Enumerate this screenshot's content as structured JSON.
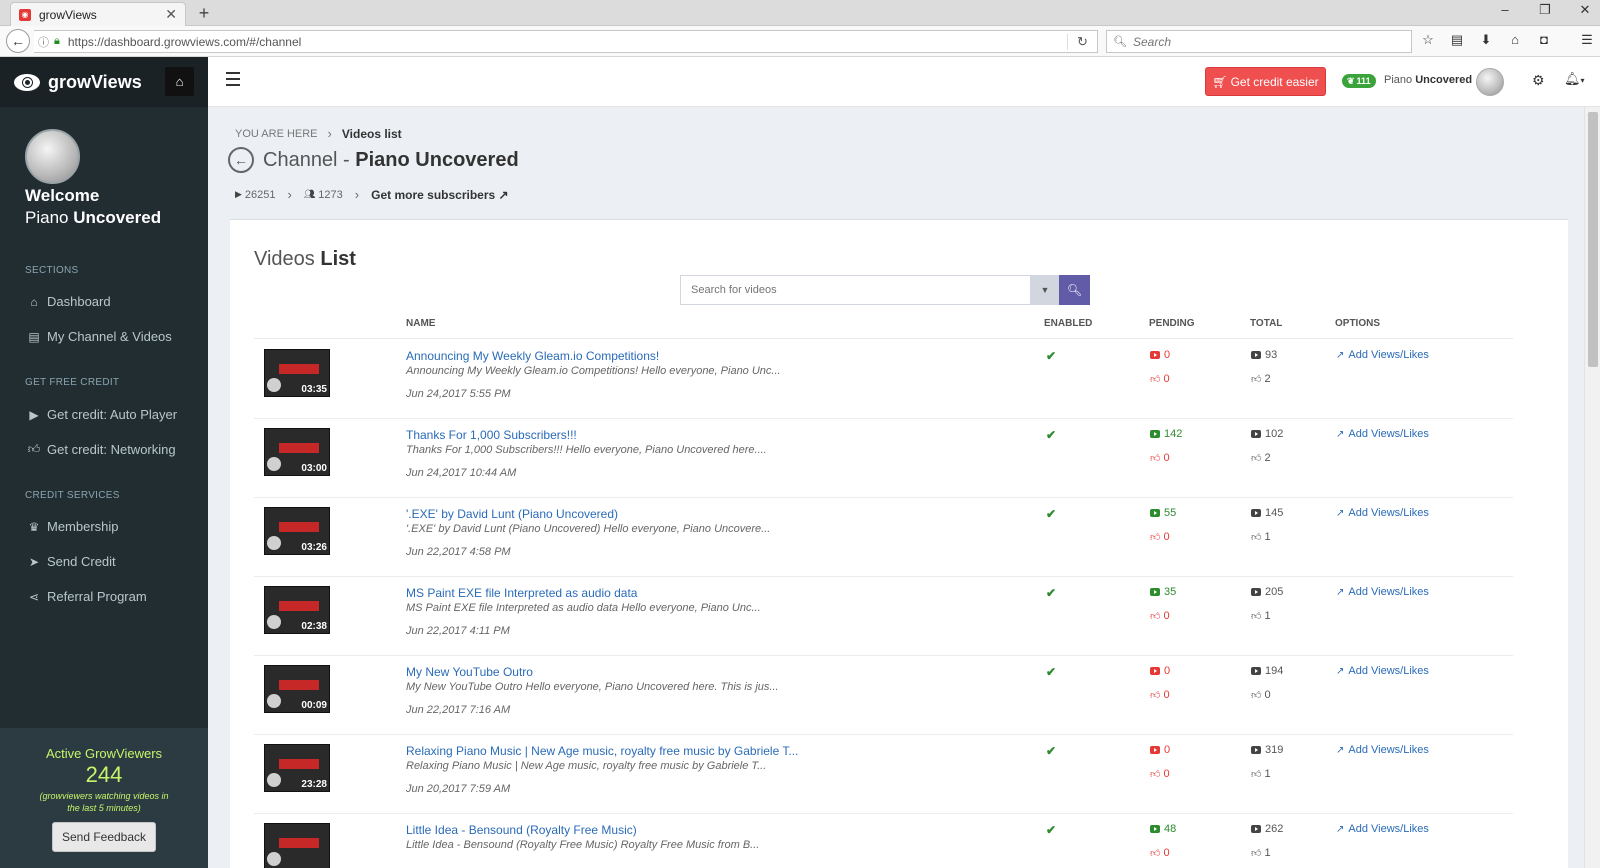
{
  "browser": {
    "tab_title": "growViews",
    "url": "https://dashboard.growviews.com/#/channel",
    "search_placeholder": "Search"
  },
  "sidebar": {
    "brand": "growViews",
    "welcome": "Welcome",
    "user_first": "Piano",
    "user_last": "Uncovered",
    "sections": [
      {
        "title": "SECTIONS",
        "items": [
          "Dashboard",
          "My Channel & Videos"
        ]
      },
      {
        "title": "GET FREE CREDIT",
        "items": [
          "Get credit: Auto Player",
          "Get credit: Networking"
        ]
      },
      {
        "title": "CREDIT SERVICES",
        "items": [
          "Membership",
          "Send Credit",
          "Referral Program"
        ]
      }
    ],
    "active_title": "Active GrowViewers",
    "active_count": "244",
    "active_note_1": "(growviewers watching videos in",
    "active_note_2": "the last 5 minutes)",
    "feedback": "Send Feedback"
  },
  "topbar": {
    "credit_button": "Get credit easier",
    "credit_count": "111",
    "user_first": "Piano",
    "user_last": "Uncovered"
  },
  "header": {
    "you_are_here": "YOU ARE HERE",
    "crumb": "Videos list",
    "title_prefix": "Channel -",
    "channel": "Piano Uncovered",
    "views": "26251",
    "subscribers": "1273",
    "more_subs": "Get more subscribers"
  },
  "panel": {
    "title_1": "Videos",
    "title_2": "List",
    "search_placeholder": "Search for videos",
    "columns": [
      "NAME",
      "ENABLED",
      "PENDING",
      "TOTAL",
      "OPTIONS"
    ],
    "option_label": "Add Views/Likes",
    "rows": [
      {
        "title": "Announcing My Weekly Gleam.io Competitions!",
        "desc": "Announcing My Weekly Gleam.io Competitions! Hello everyone, Piano Unc...",
        "date": "Jun 24,2017 5:55 PM",
        "duration": "03:35",
        "pending_views": "0",
        "pending_likes": "0",
        "total_views": "93",
        "total_likes": "2",
        "pv_color": "red"
      },
      {
        "title": "Thanks For 1,000 Subscribers!!!",
        "desc": "Thanks For 1,000 Subscribers!!! Hello everyone, Piano Uncovered here....",
        "date": "Jun 24,2017 10:44 AM",
        "duration": "03:00",
        "pending_views": "142",
        "pending_likes": "0",
        "total_views": "102",
        "total_likes": "2",
        "pv_color": "green"
      },
      {
        "title": "'.EXE' by David Lunt (Piano Uncovered)",
        "desc": "'.EXE' by David Lunt (Piano Uncovered) Hello everyone, Piano Uncovere...",
        "date": "Jun 22,2017 4:58 PM",
        "duration": "03:26",
        "pending_views": "55",
        "pending_likes": "0",
        "total_views": "145",
        "total_likes": "1",
        "pv_color": "green"
      },
      {
        "title": "MS Paint EXE file Interpreted as audio data",
        "desc": "MS Paint EXE file Interpreted as audio data Hello everyone, Piano Unc...",
        "date": "Jun 22,2017 4:11 PM",
        "duration": "02:38",
        "pending_views": "35",
        "pending_likes": "0",
        "total_views": "205",
        "total_likes": "1",
        "pv_color": "green"
      },
      {
        "title": "My New YouTube Outro",
        "desc": "My New YouTube Outro Hello everyone, Piano Uncovered here. This is jus...",
        "date": "Jun 22,2017 7:16 AM",
        "duration": "00:09",
        "pending_views": "0",
        "pending_likes": "0",
        "total_views": "194",
        "total_likes": "0",
        "pv_color": "red"
      },
      {
        "title": "Relaxing Piano Music | New Age music, royalty free music by Gabriele T...",
        "desc": "Relaxing Piano Music | New Age music, royalty free music by Gabriele T...",
        "date": "Jun 20,2017 7:59 AM",
        "duration": "23:28",
        "pending_views": "0",
        "pending_likes": "0",
        "total_views": "319",
        "total_likes": "1",
        "pv_color": "red"
      },
      {
        "title": "Little Idea - Bensound (Royalty Free Music)",
        "desc": "Little Idea - Bensound (Royalty Free Music) Royalty Free Music from B...",
        "date": "",
        "duration": "",
        "pending_views": "48",
        "pending_likes": "0",
        "total_views": "262",
        "total_likes": "1",
        "pv_color": "green"
      }
    ]
  }
}
